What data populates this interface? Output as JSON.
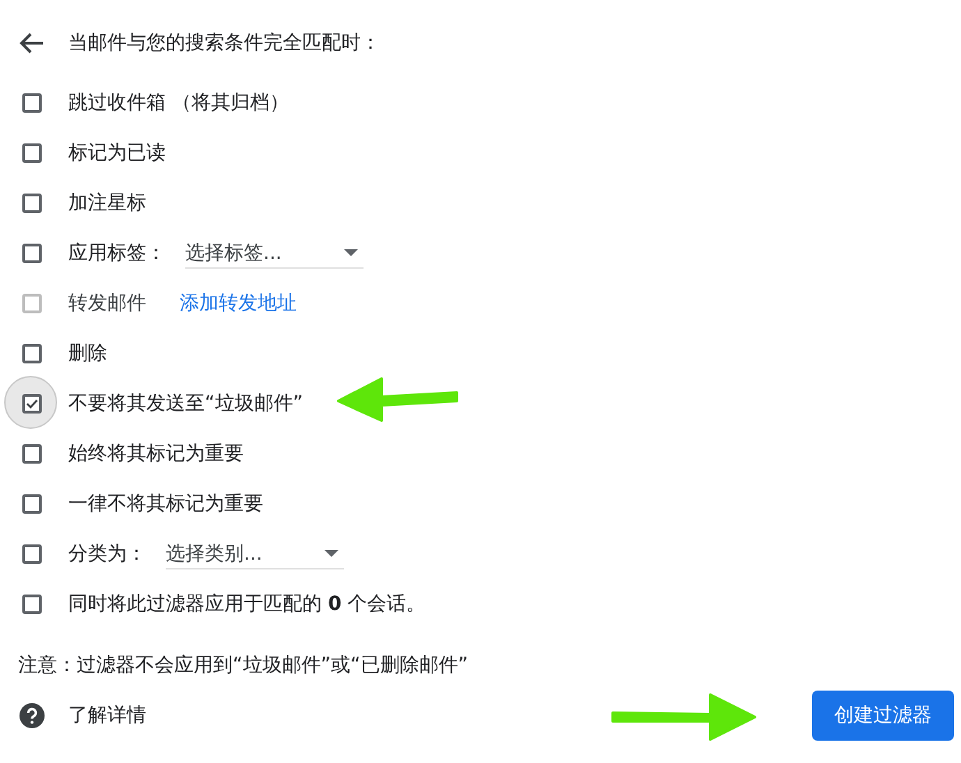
{
  "header": {
    "title": "当邮件与您的搜索条件完全匹配时："
  },
  "options": [
    {
      "kind": "plain",
      "label": "跳过收件箱 （将其归档）",
      "checked": false,
      "disabled": false,
      "focused": false
    },
    {
      "kind": "plain",
      "label": "标记为已读",
      "checked": false,
      "disabled": false,
      "focused": false
    },
    {
      "kind": "plain",
      "label": "加注星标",
      "checked": false,
      "disabled": false,
      "focused": false
    },
    {
      "kind": "select",
      "label": "应用标签：",
      "placeholder": "选择标签...",
      "checked": false,
      "disabled": false,
      "focused": false
    },
    {
      "kind": "link",
      "label": "转发邮件",
      "link": "添加转发地址",
      "checked": false,
      "disabled": true,
      "focused": false
    },
    {
      "kind": "plain",
      "label": "删除",
      "checked": false,
      "disabled": false,
      "focused": false
    },
    {
      "kind": "plain",
      "label": "不要将其发送至“垃圾邮件”",
      "checked": true,
      "disabled": false,
      "focused": true
    },
    {
      "kind": "plain",
      "label": "始终将其标记为重要",
      "checked": false,
      "disabled": false,
      "focused": false
    },
    {
      "kind": "plain",
      "label": "一律不将其标记为重要",
      "checked": false,
      "disabled": false,
      "focused": false
    },
    {
      "kind": "select",
      "label": "分类为：",
      "placeholder": "选择类别...",
      "checked": false,
      "disabled": false,
      "focused": false
    },
    {
      "kind": "plain",
      "label": "同时将此过滤器应用于匹配的 **0** 个会话。",
      "checked": false,
      "disabled": false,
      "focused": false
    }
  ],
  "note": "注意：过滤器不会应用到“垃圾邮件”或“已删除邮件”",
  "help": {
    "label": "了解详情"
  },
  "create_button": "创建过滤器",
  "annotation_arrows": [
    {
      "kind": "left_arrow"
    },
    {
      "kind": "right_arrow"
    }
  ]
}
